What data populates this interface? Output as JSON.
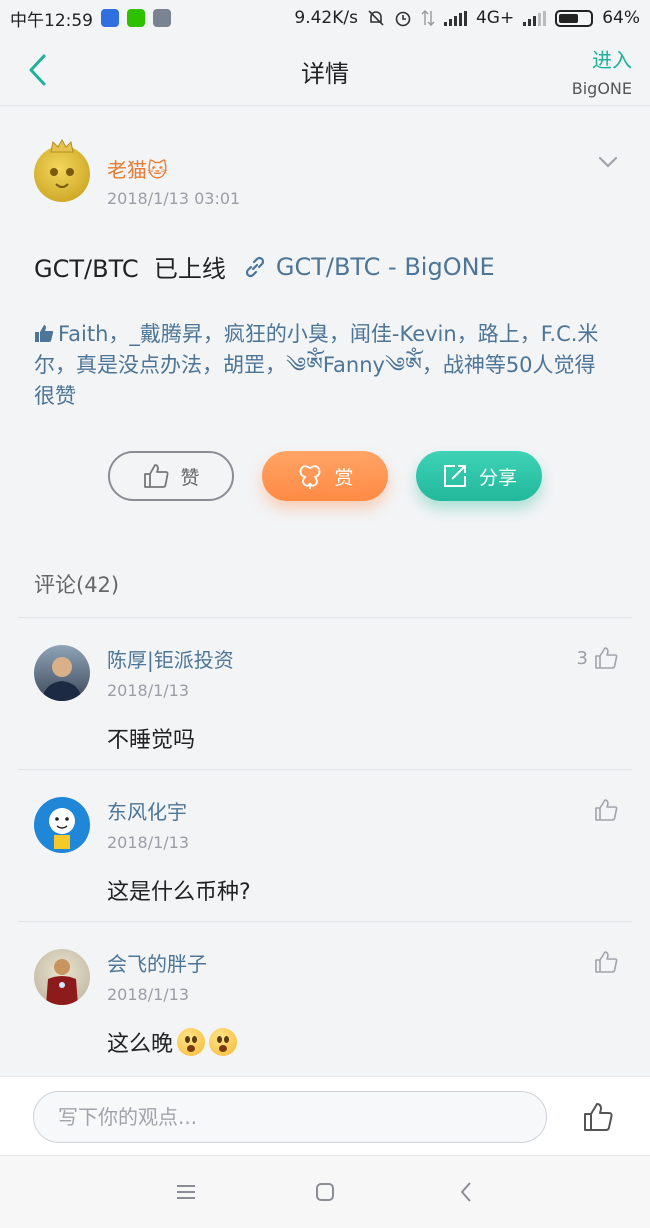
{
  "status_bar": {
    "time": "中午12:59",
    "speed": "9.42K/s",
    "network": "4G+",
    "battery": "64%",
    "battery_level": 0.64
  },
  "header": {
    "title": "详情",
    "enter_label": "进入",
    "enter_sub": "BigONE"
  },
  "post": {
    "author": "老猫🐱",
    "time": "2018/1/13 03:01",
    "content": "GCT/BTC  已上线",
    "link_text": "GCT/BTC - BigONE",
    "likers": "Faith，_戴腾昇，疯狂的小臭，闻佳-Kevin，路上，F.C.米尔，真是没点办法，胡罡，༄ༀFanny༄ༀ，战神等50人觉得很赞",
    "like_label": "赞",
    "tip_label": "赏",
    "share_label": "分享"
  },
  "comments_title": "评论(42)",
  "comments": [
    {
      "name": "陈厚|钜派投资",
      "date": "2018/1/13",
      "text": "不睡觉吗",
      "likes": "3"
    },
    {
      "name": "东风化宇",
      "date": "2018/1/13",
      "text": "这是什么币种?",
      "likes": ""
    },
    {
      "name": "会飞的胖子",
      "date": "2018/1/13",
      "text": "这么晚",
      "likes": ""
    }
  ],
  "comment_input": {
    "placeholder": "写下你的观点..."
  },
  "colors": {
    "accent": "#1fb199",
    "link": "#4d7597",
    "author": "#e87b35",
    "tip": "#ff8a44"
  },
  "icons": [
    "back-arrow-icon",
    "chevron-down-icon",
    "link-icon",
    "thumb-up-icon",
    "flower-icon",
    "share-icon",
    "menu-icon",
    "home-icon",
    "nav-back-icon"
  ]
}
